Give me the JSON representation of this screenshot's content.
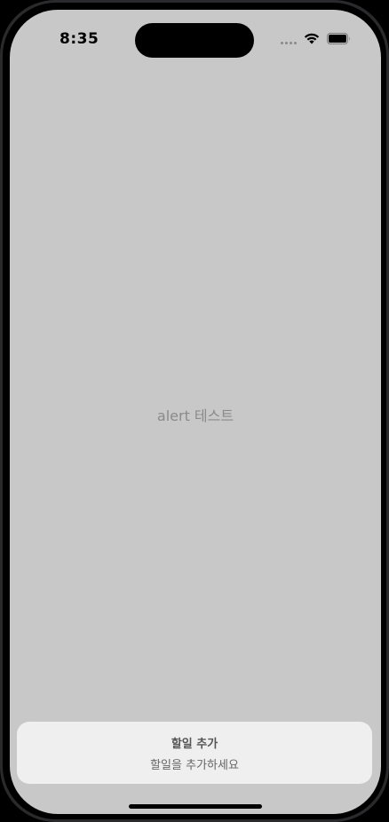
{
  "status_bar": {
    "time": "8:35",
    "icons": [
      "signal-icon",
      "wifi-icon",
      "battery-icon"
    ]
  },
  "main": {
    "center_label": "alert 테스트"
  },
  "toast": {
    "title": "할일 추가",
    "message": "할일을 추가하세요"
  },
  "colors": {
    "screen_background": "#c8c8c8",
    "toast_background": "#efefef",
    "label_text": "#8a8a8a"
  }
}
